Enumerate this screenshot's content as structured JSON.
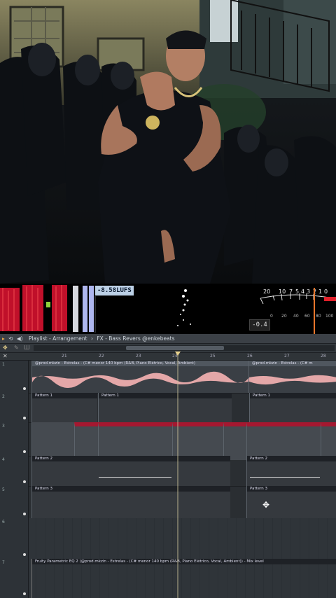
{
  "meters": {
    "lufs_readout": "-8.58LUFS",
    "vu_readout": "-0.4",
    "vu_scale_top": [
      "20",
      "10",
      "7",
      "5",
      "4",
      "3",
      "2",
      "1",
      "0"
    ],
    "vu_scale_bottom": [
      "0",
      "20",
      "40",
      "60",
      "80",
      "100"
    ]
  },
  "playlist": {
    "title": "Playlist - Arrangement",
    "separator": "›",
    "pattern": "FX - Bass Revers @enkebeats",
    "ruler_marks": [
      "21",
      "22",
      "23",
      "24",
      "25",
      "26",
      "27",
      "28"
    ],
    "lane_numbers": [
      "1",
      "2",
      "3",
      "4",
      "5",
      "6",
      "7"
    ],
    "audio_clip_label": "@prod.mkzin - Estrelas - (C# menor 140 bpm (R&B, Piano Elétrico, Vocal, Ambient)",
    "audio_clip_label_2": "@prod.mkzin - Estrelas - (C# m",
    "pattern1": "Pattern 1",
    "pattern2": "Pattern 2",
    "pattern3": "Pattern 3",
    "automation_label": "Fruity Parametric EQ 2 (@prod.mkzin - Estrelas - (C# menor 140 bpm (R&B, Piano Elétrico, Vocal, Ambient)) - Mix level"
  },
  "colors": {
    "accent_red": "#c0102a",
    "waveform_pink": "#e4a7a8",
    "daw_bg": "#2a2e32"
  },
  "icons": [
    "arrow-right-icon",
    "snap-icon",
    "speaker-icon",
    "close-icon",
    "pencil-icon",
    "brush-icon",
    "magnet-icon"
  ]
}
